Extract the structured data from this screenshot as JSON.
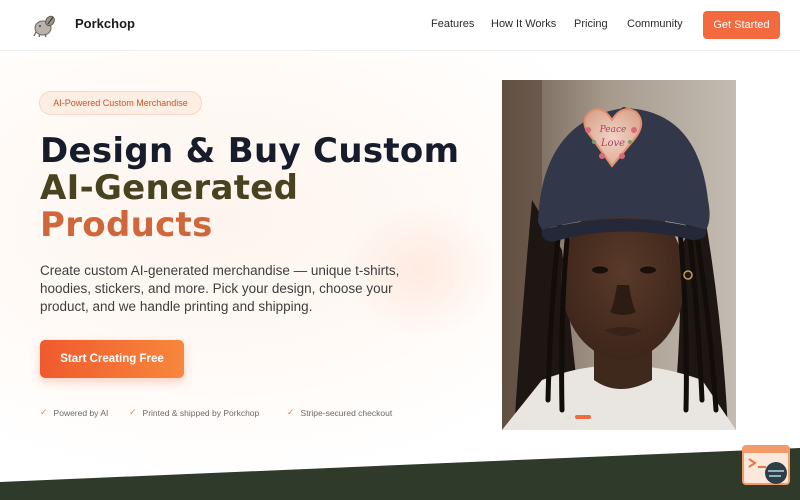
{
  "nav": {
    "brand": "Porkchop",
    "links": [
      "Features",
      "How It Works",
      "Pricing",
      "Community"
    ],
    "cta": "Get Started"
  },
  "hero": {
    "badge": "AI-Powered Custom Merchandise",
    "headline": [
      "Design & Buy Custom",
      "AI-Generated",
      "Products"
    ],
    "description": "Create custom AI-generated merchandise — unique t-shirts, hoodies, stickers, and more. Pick your design, choose your product, and we handle printing and shipping.",
    "cta": "Start Creating Free",
    "features": [
      "Powered by AI",
      "Printed & shipped by Porkchop",
      "Stripe-secured checkout"
    ]
  },
  "carousel": {
    "slide_count": 2,
    "active_index": 1
  },
  "colors": {
    "accent": "#f26a3d",
    "headline_dark": "#161c2c",
    "headline_olive": "#48421f",
    "headline_orange": "#d0663a",
    "footer_green": "#2f3a2b"
  },
  "icons": [
    "pig-logo-icon",
    "check-icon",
    "support-chat-icon"
  ]
}
